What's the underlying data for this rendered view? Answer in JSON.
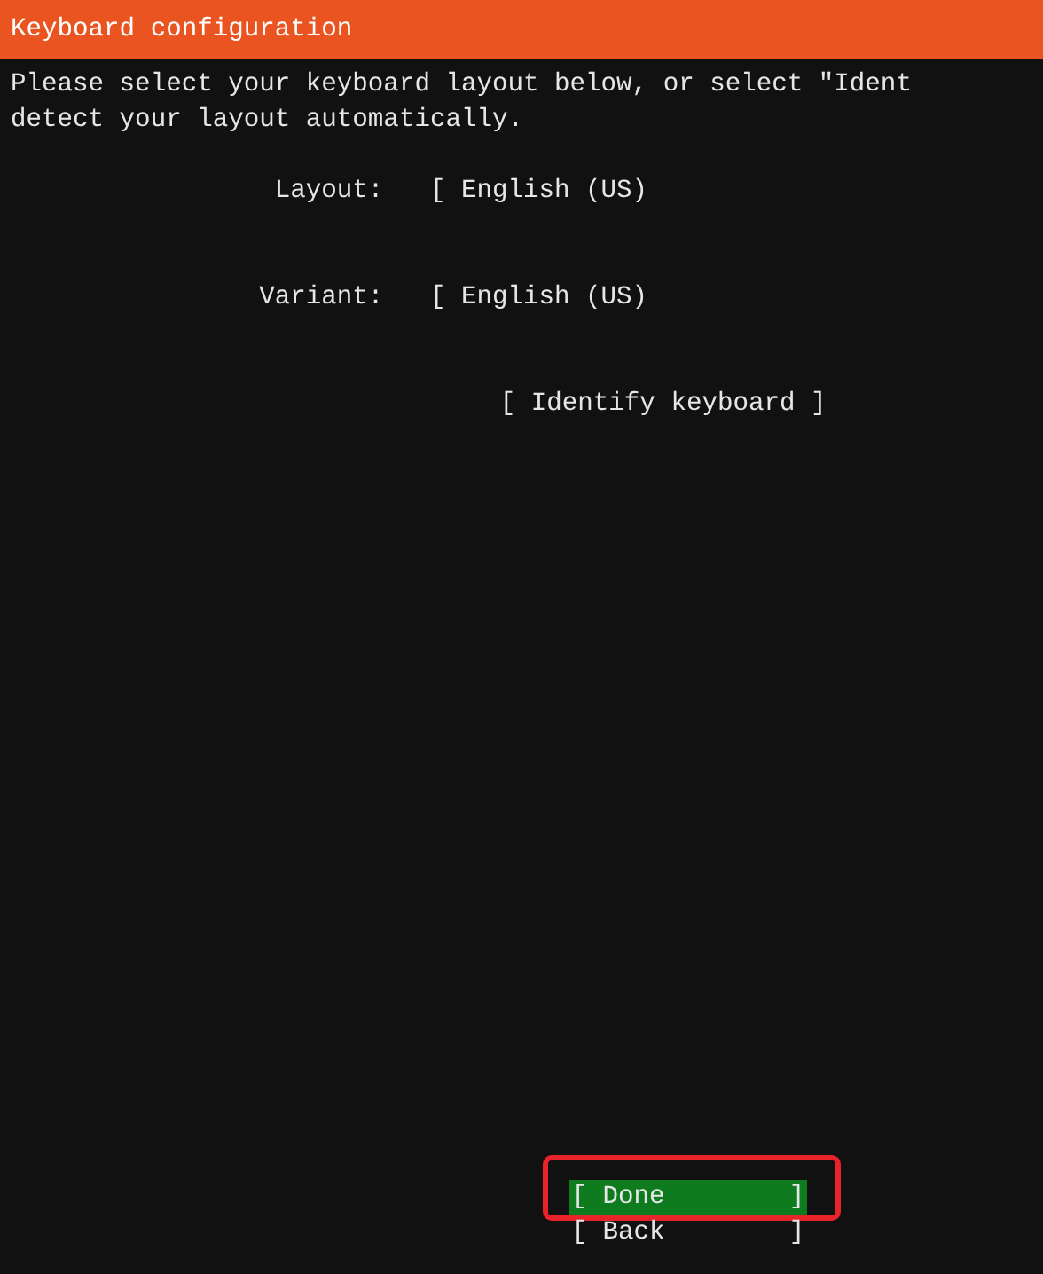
{
  "window": {
    "title": "Keyboard configuration"
  },
  "intro": [
    "Please select your keyboard layout below, or select \"Ident",
    "detect your layout automatically."
  ],
  "fields": [
    {
      "label": "Layout:",
      "value": "[ English (US)"
    },
    {
      "label": "Variant:",
      "value": "[ English (US)"
    }
  ],
  "identify_button": {
    "label": "[ Identify keyboard ]"
  },
  "buttons": [
    {
      "label": "[ Done        ]",
      "selected": true,
      "highlighted": true
    },
    {
      "label": "[ Back        ]",
      "selected": false,
      "highlighted": false
    }
  ]
}
